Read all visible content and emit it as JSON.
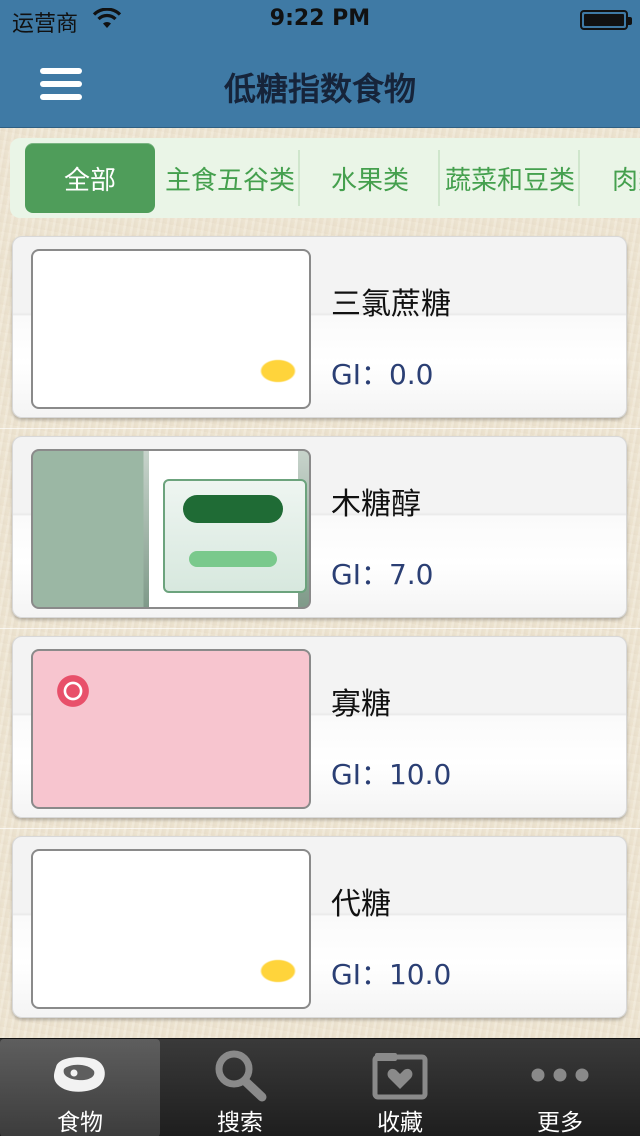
{
  "status_bar": {
    "carrier": "运营商",
    "time": "9:22 PM"
  },
  "nav": {
    "title": "低糖指数食物",
    "menu_icon": "hamburger-menu-icon"
  },
  "categories": [
    {
      "label": "全部",
      "active": true
    },
    {
      "label": "主食五谷类",
      "active": false
    },
    {
      "label": "水果类",
      "active": false
    },
    {
      "label": "蔬菜和豆类",
      "active": false
    },
    {
      "label": "肉类",
      "active": false
    }
  ],
  "foods": [
    {
      "name": "三氯蔗糖",
      "gi": "GI：0.0",
      "image": "breakfast-photo"
    },
    {
      "name": "木糖醇",
      "gi": "GI：7.0",
      "image": "xylitol-bags-photo"
    },
    {
      "name": "寡糖",
      "gi": "GI：10.0",
      "image": "jelly-candy-photo"
    },
    {
      "name": "代糖",
      "gi": "GI：10.0",
      "image": "breakfast-photo"
    }
  ],
  "tabbar": [
    {
      "label": "食物",
      "icon": "meat-icon",
      "selected": true
    },
    {
      "label": "搜索",
      "icon": "search-icon",
      "selected": false
    },
    {
      "label": "收藏",
      "icon": "favorites-heart-folder-icon",
      "selected": false
    },
    {
      "label": "更多",
      "icon": "more-dots-icon",
      "selected": false
    }
  ],
  "colors": {
    "nav_bar": "#3f7aa5",
    "active_tab": "#4f9d5a",
    "tab_text": "#45a04e",
    "gi_text": "#2b3f74",
    "tabbar_bg": "#2a2a2a"
  }
}
